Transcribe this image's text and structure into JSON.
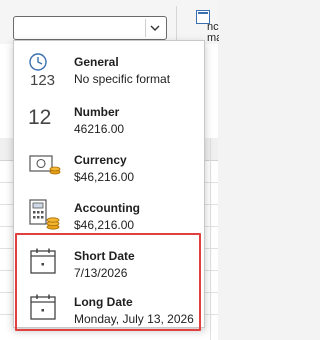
{
  "combo": {
    "value": "",
    "dropdown_icon": "chevron-down-icon"
  },
  "ribbon": {
    "fragment_text_1": "nc",
    "fragment_text_2": "ma"
  },
  "formats": [
    {
      "title": "General",
      "sub": "No specific format",
      "icon": "clock-123-icon",
      "icon_text": "123"
    },
    {
      "title": "Number",
      "sub": "46216.00",
      "icon": "number-12-icon",
      "icon_text": "12"
    },
    {
      "title": "Currency",
      "sub": "$46,216.00",
      "icon": "currency-icon"
    },
    {
      "title": "Accounting",
      "sub": " $46,216.00",
      "icon": "accounting-icon"
    },
    {
      "title": "Short Date",
      "sub": "7/13/2026",
      "icon": "calendar-icon"
    },
    {
      "title": "Long Date",
      "sub": "Monday, July 13, 2026",
      "icon": "calendar-icon"
    }
  ],
  "colors": {
    "highlight": "#e04040",
    "icon_blue": "#3a6fb0",
    "icon_gold": "#e6a21a"
  }
}
